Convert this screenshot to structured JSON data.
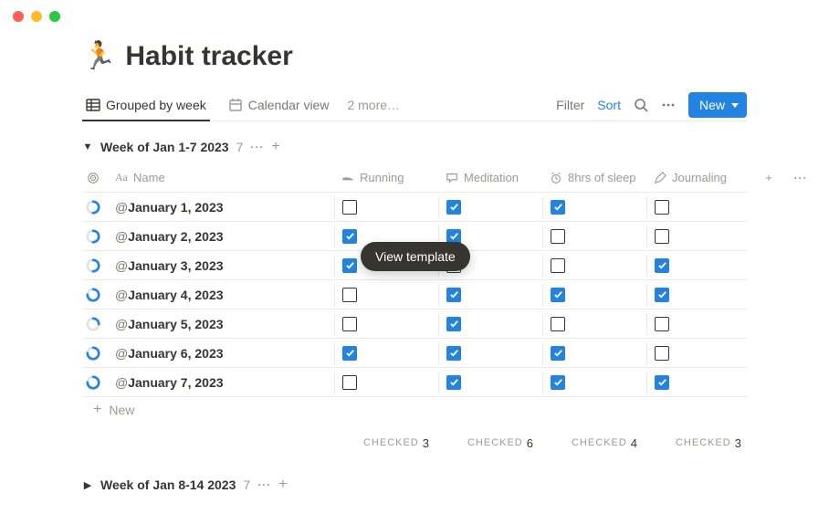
{
  "title": {
    "emoji": "🏃",
    "text": "Habit tracker"
  },
  "tabs": {
    "grouped": "Grouped by week",
    "calendar": "Calendar view",
    "more": "2 more…"
  },
  "toolbar": {
    "filter": "Filter",
    "sort": "Sort",
    "new": "New"
  },
  "columns": {
    "name": "Name",
    "running": "Running",
    "meditation": "Meditation",
    "sleep": "8hrs of sleep",
    "journaling": "Journaling"
  },
  "group1": {
    "title": "Week of Jan 1-7 2023",
    "count": "7",
    "rows": [
      {
        "name": "January 1, 2023",
        "progress": 50,
        "running": false,
        "meditation": true,
        "sleep": true,
        "journaling": false
      },
      {
        "name": "January 2, 2023",
        "progress": 50,
        "running": true,
        "meditation": true,
        "sleep": false,
        "journaling": false
      },
      {
        "name": "January 3, 2023",
        "progress": 50,
        "running": true,
        "meditation": false,
        "sleep": false,
        "journaling": true
      },
      {
        "name": "January 4, 2023",
        "progress": 75,
        "running": false,
        "meditation": true,
        "sleep": true,
        "journaling": true
      },
      {
        "name": "January 5, 2023",
        "progress": 25,
        "running": false,
        "meditation": true,
        "sleep": false,
        "journaling": false
      },
      {
        "name": "January 6, 2023",
        "progress": 75,
        "running": true,
        "meditation": true,
        "sleep": true,
        "journaling": false
      },
      {
        "name": "January 7, 2023",
        "progress": 75,
        "running": false,
        "meditation": true,
        "sleep": true,
        "journaling": true
      }
    ],
    "footer_label": "CHECKED",
    "footer": {
      "running": "3",
      "meditation": "6",
      "sleep": "4",
      "journaling": "3"
    }
  },
  "group2": {
    "title": "Week of Jan 8-14 2023",
    "count": "7"
  },
  "new_row_label": "New",
  "view_template": "View template"
}
